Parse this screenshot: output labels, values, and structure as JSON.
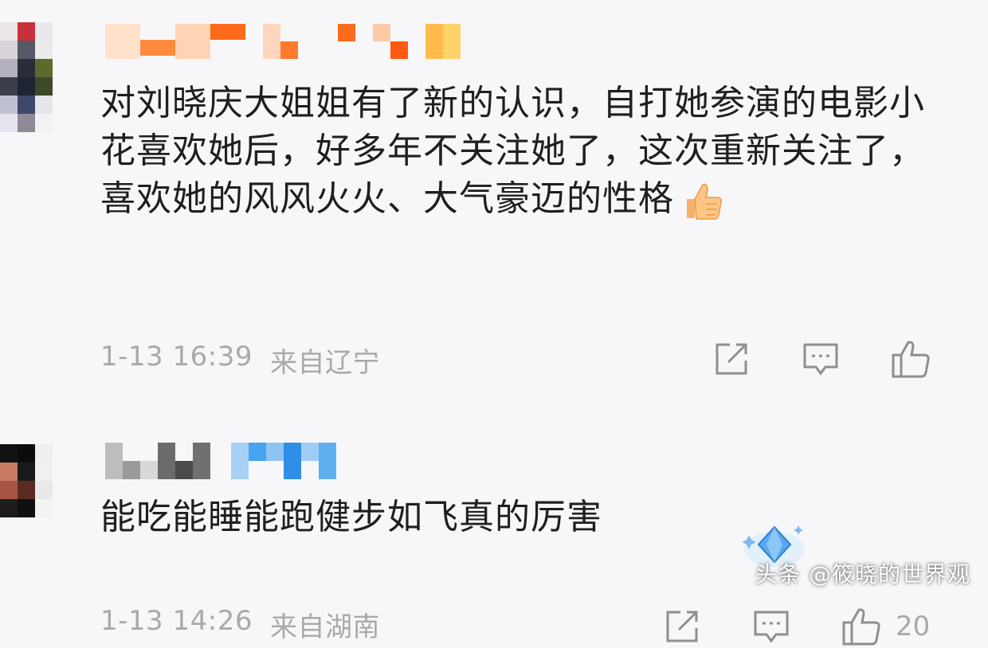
{
  "comments": [
    {
      "body": "对刘晓庆大姐姐有了新的认识，自打她参演的电影小花喜欢她后，好多年不关注她了，这次重新关注了，喜欢她的风风火火、大气豪迈的性格",
      "emoji": "thumbs-up-emoji",
      "time": "1-13 16:39",
      "location": "来自辽宁"
    },
    {
      "body": "能吃能睡能跑健步如飞真的厉害",
      "time": "1-13 14:26",
      "location": "来自湖南",
      "like_count": "20"
    }
  ],
  "icons": [
    "share-icon",
    "comment-icon",
    "like-icon",
    "diamond-badge-icon"
  ],
  "watermark": "头条 @筱晓的世界观",
  "colors": {
    "background": "#f7f7f9",
    "meta_text": "#a9a9ad",
    "body_text": "#1f1f1f"
  }
}
